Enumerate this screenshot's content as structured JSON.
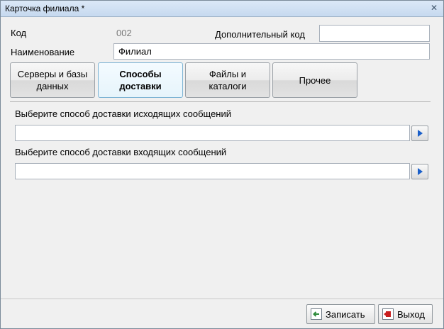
{
  "window": {
    "title": "Карточка филиала *",
    "close_glyph": "✕"
  },
  "fields": {
    "code_label": "Код",
    "code_value": "002",
    "extra_code_label": "Дополнительный код",
    "extra_code_value": "",
    "name_label": "Наименование",
    "name_value": "Филиал"
  },
  "tabs": [
    {
      "label": "Серверы и базы\nданных",
      "active": false
    },
    {
      "label": "Способы\nдоставки",
      "active": true
    },
    {
      "label": "Файлы и\nкаталоги",
      "active": false
    },
    {
      "label": "Прочее",
      "active": false
    }
  ],
  "delivery": {
    "outgoing_label": "Выберите способ доставки исходящих сообщений",
    "outgoing_value": "",
    "incoming_label": "Выберите способ доставки входящих сообщений",
    "incoming_value": ""
  },
  "footer": {
    "save_label": "Записать",
    "exit_label": "Выход",
    "save_icon": "save-arrow-icon",
    "exit_icon": "exit-icon"
  },
  "colors": {
    "accent": "#1a5fc9",
    "save_icon": "#2e8b3a",
    "exit_icon": "#c81e1e"
  }
}
